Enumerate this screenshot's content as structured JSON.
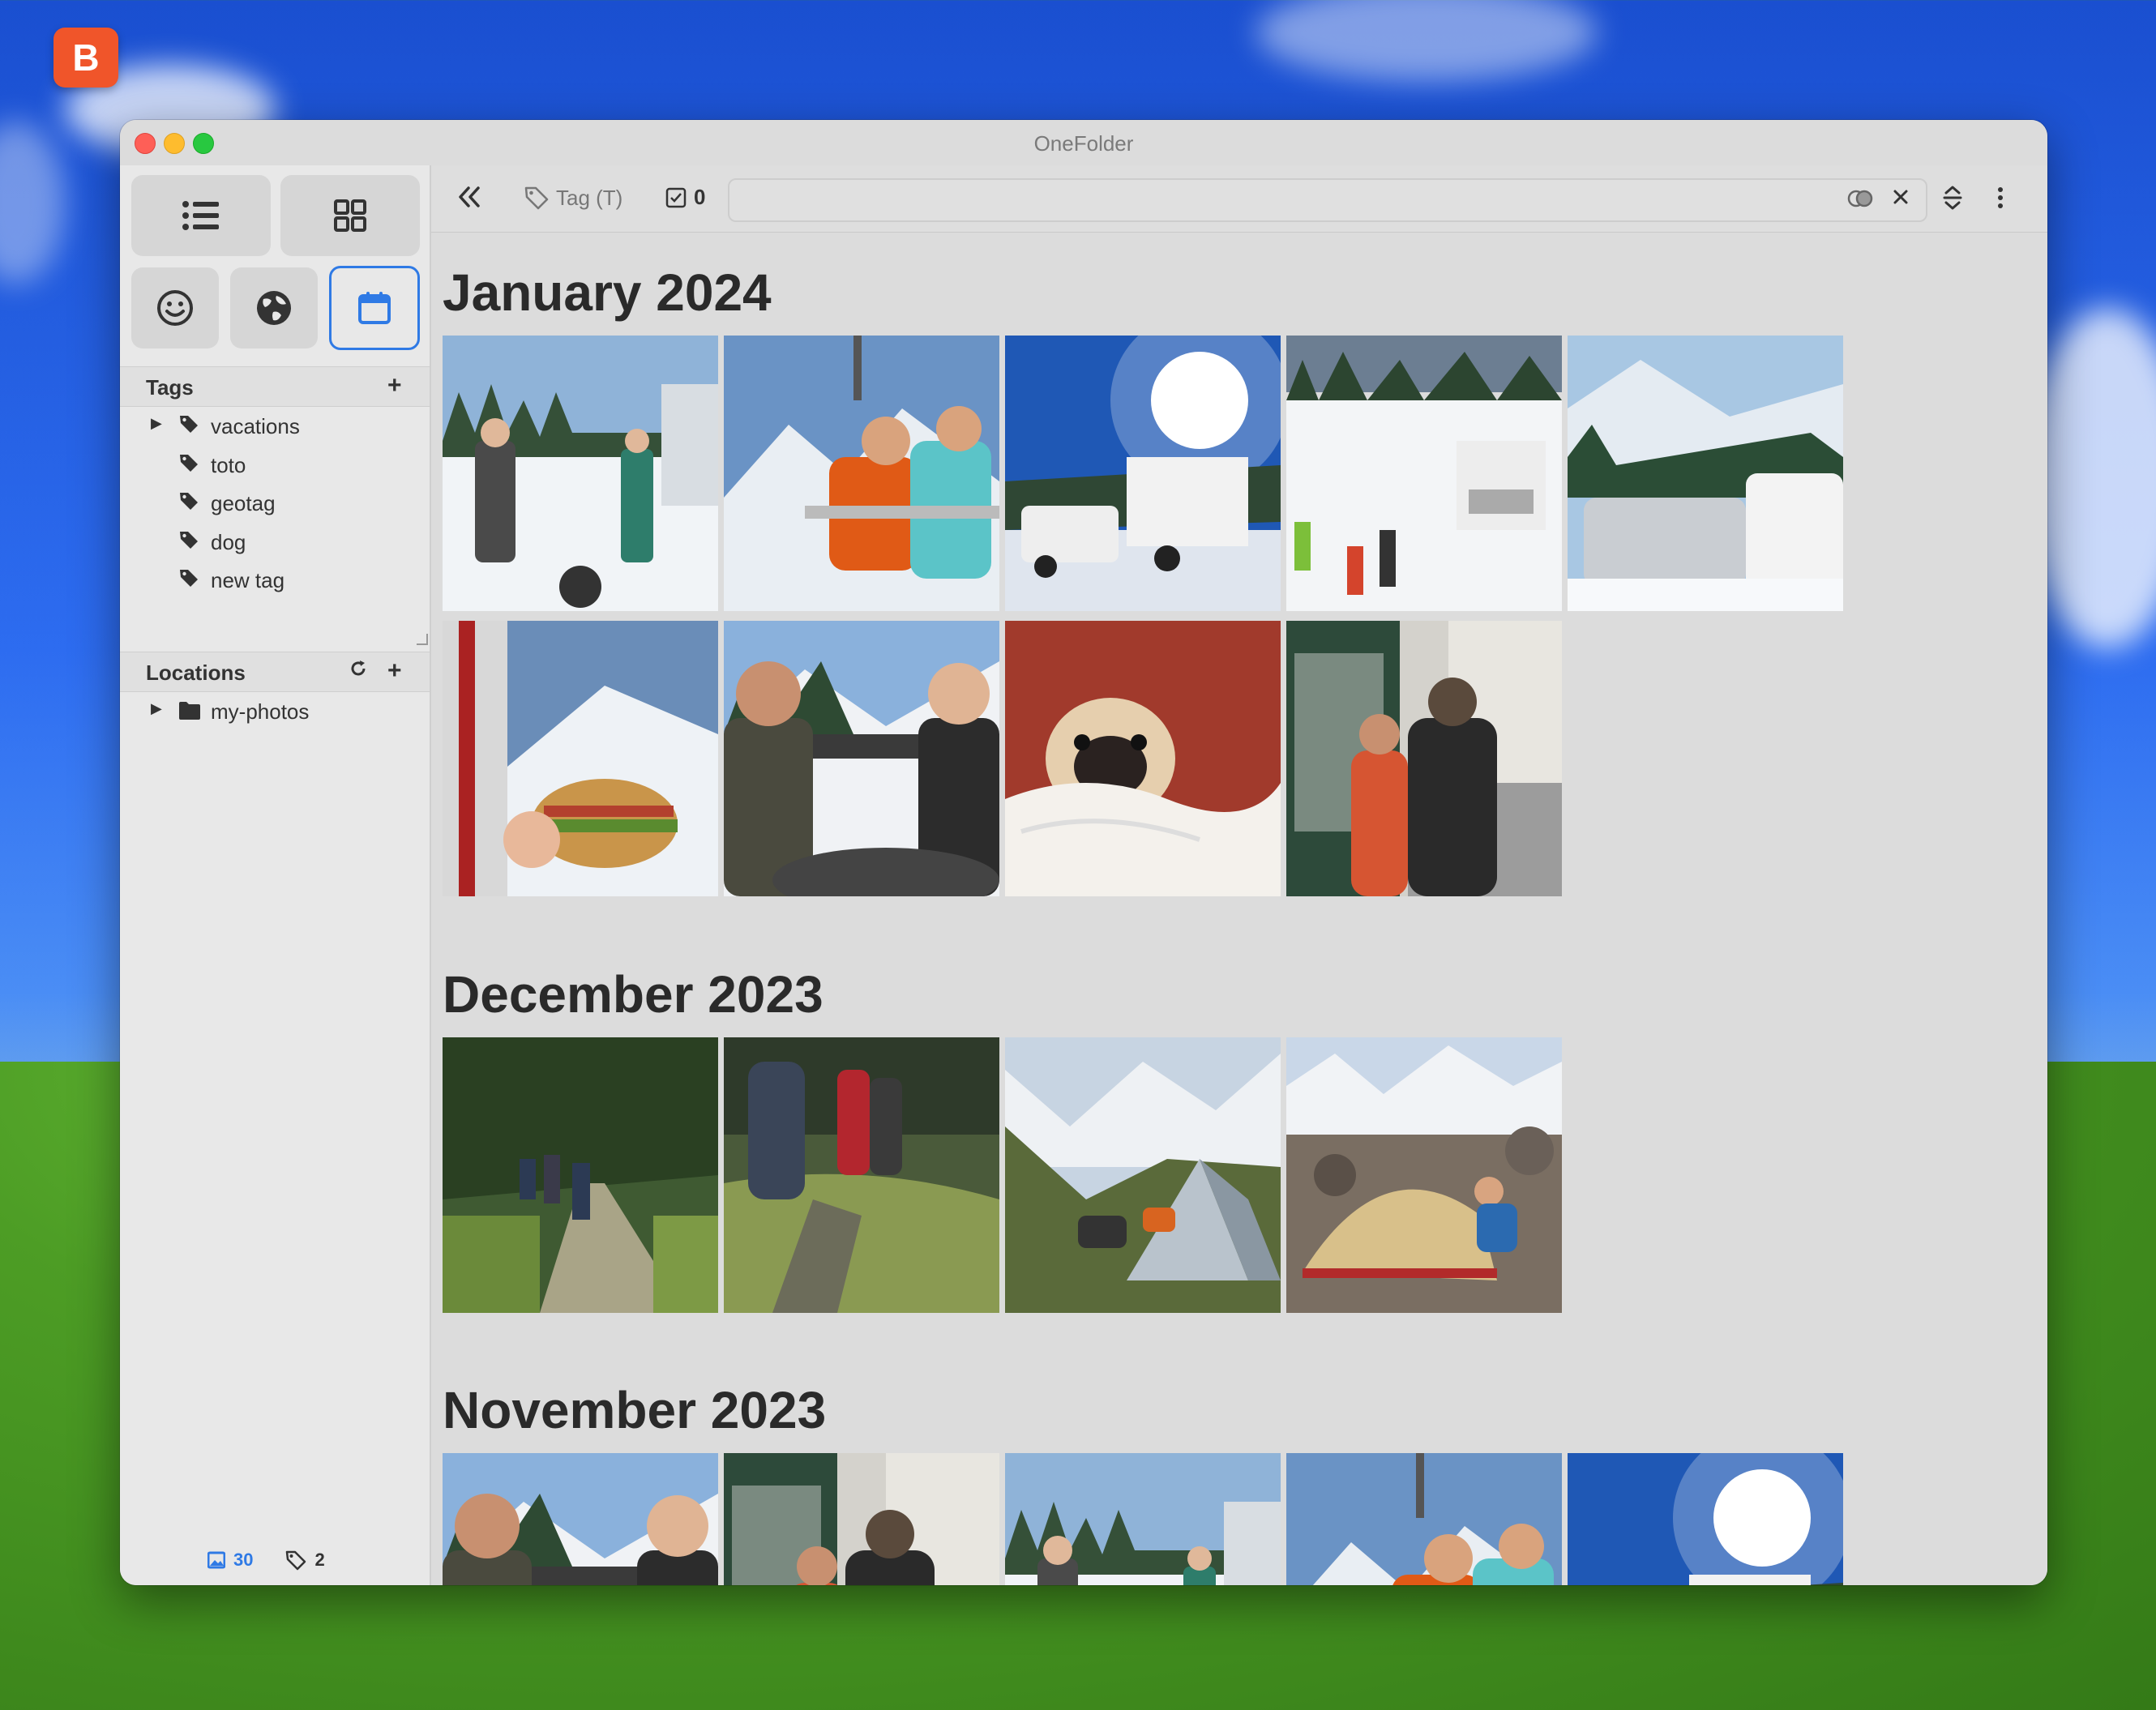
{
  "app": {
    "title": "OneFolder",
    "dock_letter": "B"
  },
  "colors": {
    "accent": "#2f7ae5",
    "window_bg": "#e4e4e4"
  },
  "toolbar": {
    "collapse_icon": "double-chevron-left-icon",
    "tag_label": "Tag (T)",
    "selected_count": "0",
    "search_value": "",
    "search_placeholder": ""
  },
  "sidebar": {
    "view_buttons": [
      "list-view-icon",
      "grid-view-icon",
      "smiley-icon",
      "globe-icon",
      "calendar-icon"
    ],
    "tags_header": "Tags",
    "tags": [
      {
        "label": "vacations",
        "expandable": true
      },
      {
        "label": "toto",
        "expandable": false
      },
      {
        "label": "geotag",
        "expandable": false
      },
      {
        "label": "dog",
        "expandable": false
      },
      {
        "label": "new tag",
        "expandable": false
      }
    ],
    "locations_header": "Locations",
    "locations": [
      {
        "label": "my-photos",
        "expandable": true
      }
    ],
    "status": {
      "image_count": "30",
      "tag_count": "2"
    }
  },
  "gallery": {
    "groups": [
      {
        "title": "January 2024",
        "photos": [
          "snow-camp-group",
          "chairlift-couple",
          "rv-sunny-snow",
          "skiers-walking-to-rv",
          "snowed-in-vans",
          "sandwich-on-skis",
          "friends-on-deck",
          "pug-in-blanket",
          "people-on-bus"
        ]
      },
      {
        "title": "December 2023",
        "photos": [
          "forest-trail-hikers",
          "hikers-in-grass",
          "tent-in-valley",
          "tent-in-rocks"
        ]
      },
      {
        "title": "November 2023",
        "photos": [
          "friends-on-deck",
          "people-on-bus",
          "snow-camp-group",
          "chairlift-couple",
          "rv-sunny-snow"
        ]
      }
    ]
  }
}
